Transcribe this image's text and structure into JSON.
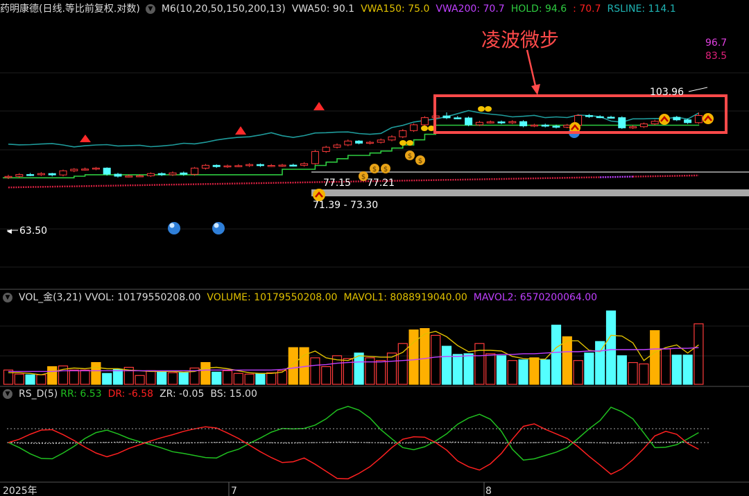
{
  "colors": {
    "up": "#ff3b3b",
    "down": "#54ffff",
    "gold": "#ffb000",
    "hold_line": "#2ecc40",
    "rsline": "#1f9c9c",
    "vwa200": "#d42040",
    "vwa_purple": "#c040ff",
    "mavol1": "#e0c000",
    "mavol2": "#c040ff",
    "rr": "#20c020",
    "dr": "#ff2020",
    "annot_box": "#ff4a4a"
  },
  "main_header": {
    "title": "药明康德(日线.等比前复权.对数)",
    "indicator": "M6(10,20,50,150,200,13)",
    "vwa50": "VWA50: 90.1",
    "vwa150": "VWA150: 75.0",
    "vwa200": "VWA200: 70.7",
    "hold": "HOLD: 94.6",
    "hold2": ": 70.7",
    "rsline": "RSLINE: 114.1"
  },
  "annotations": {
    "callout": "凌波微步",
    "rs_top": "96.7",
    "rs_second": "83.5",
    "high": "103.96",
    "left_price": "63.50",
    "zone_a": "77.15",
    "zone_b": "77.21",
    "zone_range": "71.39 - 73.30"
  },
  "vol_header": {
    "name": "VOL_金(3,21)",
    "vvol": "VVOL: 10179550208.00",
    "volume": "VOLUME: 10179550208.00",
    "mavol1": "MAVOL1: 8088919040.00",
    "mavol2": "MAVOL2: 6570200064.00"
  },
  "rs_header": {
    "name": "RS_D(5)",
    "rr": "RR: 6.53",
    "dr": "DR: -6.58",
    "zr": "ZR: -0.05",
    "bs": "BS: 15.00"
  },
  "xaxis": {
    "labels": [
      "2025年",
      "7",
      "8"
    ]
  },
  "chart_data": [
    {
      "type": "candlestick",
      "panel": "price",
      "scale": "log",
      "x": [
        1,
        2,
        3,
        4,
        5,
        6,
        7,
        8,
        9,
        10,
        11,
        12,
        13,
        14,
        15,
        16,
        17,
        18,
        19,
        20,
        21,
        22,
        23,
        24,
        25,
        26,
        27,
        28,
        29,
        30,
        31,
        32,
        33,
        34,
        35,
        36,
        37,
        38,
        39,
        40,
        41,
        42,
        43,
        44,
        45,
        46,
        47,
        48,
        49,
        50,
        51,
        52,
        53,
        54,
        55,
        56,
        57,
        58,
        59,
        60,
        61,
        62,
        63,
        64
      ],
      "open": [
        62.7,
        63.2,
        64.1,
        64.0,
        64.6,
        63.9,
        66.0,
        66.8,
        66.9,
        67.4,
        64.3,
        63.3,
        63.4,
        63.5,
        64.6,
        64.0,
        64.9,
        64.2,
        67.4,
        68.9,
        68.2,
        68.6,
        68.7,
        69.3,
        68.7,
        68.8,
        69.0,
        68.9,
        69.8,
        76.7,
        79.3,
        80.7,
        83.2,
        81.8,
        82.4,
        83.9,
        86.0,
        90.2,
        94.4,
        99.8,
        101.2,
        99.7,
        99.6,
        94.4,
        96.3,
        96.6,
        95.9,
        96.8,
        93.6,
        94.2,
        93.4,
        92.7,
        94.1,
        101.5,
        100.6,
        100.2,
        99.8,
        92.2,
        93.0,
        95.1,
        97.0,
        100.1,
        98.1,
        96.0
      ],
      "close": [
        63.2,
        64.1,
        64.0,
        64.6,
        63.9,
        66.0,
        66.8,
        66.9,
        67.4,
        64.3,
        63.3,
        63.4,
        63.5,
        64.6,
        64.0,
        64.9,
        64.2,
        67.4,
        68.9,
        68.2,
        68.6,
        68.7,
        69.3,
        68.7,
        68.8,
        69.0,
        68.9,
        69.8,
        76.7,
        79.3,
        80.7,
        83.2,
        81.8,
        82.4,
        83.9,
        86.0,
        90.2,
        94.4,
        99.8,
        101.2,
        99.7,
        99.6,
        94.4,
        96.3,
        96.6,
        95.9,
        96.8,
        93.6,
        94.2,
        93.4,
        92.7,
        94.1,
        101.5,
        100.6,
        100.2,
        99.8,
        92.2,
        93.0,
        95.1,
        97.0,
        100.1,
        98.1,
        96.0,
        101.5
      ],
      "high": [
        64.0,
        64.8,
        64.9,
        65.3,
        65.0,
        66.6,
        67.4,
        67.7,
        68.0,
        67.8,
        64.9,
        64.2,
        64.2,
        65.2,
        65.2,
        65.7,
        65.6,
        68.0,
        69.6,
        69.4,
        69.3,
        69.5,
        70.0,
        69.9,
        69.6,
        69.7,
        69.8,
        70.6,
        77.7,
        80.2,
        81.7,
        84.2,
        83.8,
        83.3,
        84.9,
        87.1,
        91.3,
        95.5,
        101.0,
        102.5,
        104.0,
        101.2,
        100.7,
        97.4,
        97.7,
        97.6,
        97.9,
        97.9,
        95.2,
        95.3,
        94.5,
        95.1,
        102.6,
        102.7,
        101.7,
        101.3,
        100.9,
        94.1,
        96.1,
        98.2,
        101.3,
        101.2,
        99.2,
        103.96
      ],
      "low": [
        61.9,
        62.5,
        63.3,
        63.4,
        63.2,
        63.2,
        65.3,
        66.1,
        66.3,
        63.6,
        62.6,
        62.7,
        62.8,
        62.9,
        63.4,
        63.4,
        63.5,
        63.5,
        66.6,
        67.5,
        67.5,
        67.9,
        68.0,
        68.0,
        68.0,
        68.1,
        68.2,
        68.2,
        69.1,
        75.9,
        78.5,
        79.9,
        81.1,
        81.0,
        81.6,
        83.1,
        85.1,
        89.3,
        93.5,
        98.9,
        98.7,
        98.6,
        93.4,
        93.5,
        95.4,
        94.9,
        95.0,
        92.6,
        92.7,
        92.5,
        91.7,
        91.9,
        93.2,
        99.6,
        99.4,
        99.1,
        91.4,
        91.4,
        92.1,
        94.1,
        96.1,
        97.2,
        95.1,
        95.1
      ]
    },
    {
      "type": "line",
      "panel": "price",
      "name": "HOLD",
      "y": [
        62.5,
        62.5,
        62.5,
        62.5,
        62.5,
        62.5,
        63.3,
        64.0,
        64.0,
        64.0,
        64.0,
        64.0,
        64.0,
        64.0,
        64.0,
        64.0,
        64.0,
        64.0,
        64.0,
        64.0,
        64.0,
        64.0,
        64.0,
        64.0,
        64.0,
        66.8,
        66.8,
        66.8,
        68.8,
        70.6,
        72.5,
        74.4,
        74.4,
        75.8,
        77.0,
        78.8,
        80.7,
        84.0,
        87.7,
        94.1,
        94.1,
        94.1,
        94.1,
        94.1,
        94.1,
        94.1,
        94.1,
        94.1,
        94.1,
        94.1,
        94.1,
        94.1,
        94.1,
        94.1,
        94.1,
        94.1,
        94.1,
        94.1,
        94.1,
        94.1,
        94.1,
        94.1,
        94.1,
        94.6
      ]
    },
    {
      "type": "line",
      "panel": "price",
      "name": "RSLINE",
      "y": [
        81.2,
        80.8,
        80.9,
        81.3,
        81.6,
        80.7,
        79.5,
        80.2,
        80.7,
        80.9,
        80.1,
        80.3,
        80.5,
        79.6,
        80.1,
        80.7,
        81.8,
        81.4,
        82.4,
        83.9,
        84.9,
        85.7,
        86.0,
        87.2,
        88.8,
        86.7,
        85.6,
        86.8,
        88.6,
        88.8,
        89.2,
        89.3,
        88.2,
        87.7,
        88.3,
        92.4,
        94.0,
        96.5,
        97.7,
        98.8,
        100.6,
        103.0,
        105.4,
        103.7,
        102.6,
        101.8,
        100.4,
        100.9,
        101.6,
        99.8,
        100.4,
        99.9,
        101.9,
        101.4,
        100.6,
        97.2,
        96.4,
        98.9,
        98.9,
        99.2,
        99.0,
        100.2,
        98.7,
        103.5
      ]
    },
    {
      "type": "line",
      "panel": "price",
      "name": "VWA200",
      "y": [
        58.0,
        58.08,
        58.16,
        58.25,
        58.33,
        58.41,
        58.5,
        58.58,
        58.67,
        58.75,
        58.84,
        58.92,
        59.01,
        59.1,
        59.18,
        59.27,
        59.35,
        59.44,
        59.53,
        59.61,
        59.7,
        59.79,
        59.88,
        59.97,
        60.05,
        60.14,
        60.23,
        60.32,
        60.41,
        60.5,
        60.59,
        60.68,
        60.77,
        60.86,
        60.95,
        61.04,
        61.13,
        61.22,
        61.31,
        61.4,
        61.49,
        61.58,
        61.68,
        61.77,
        61.86,
        61.95,
        62.04,
        62.14,
        62.23,
        62.32,
        62.42,
        62.51,
        62.61,
        62.7,
        62.79,
        62.89,
        62.98,
        63.08,
        63.17,
        63.27,
        63.36,
        63.46,
        63.55,
        63.65
      ]
    },
    {
      "type": "bar",
      "panel": "volume",
      "name": "VOLUME",
      "values": [
        2.1,
        1.5,
        1.4,
        1.4,
        2.6,
        2.7,
        2.1,
        2.1,
        3.2,
        1.6,
        2.2,
        2.5,
        1.3,
        2.0,
        1.9,
        1.7,
        1.7,
        2.4,
        3.2,
        1.8,
        2.0,
        1.6,
        1.5,
        1.6,
        1.7,
        2.0,
        5.4,
        5.4,
        3.9,
        2.6,
        4.2,
        3.8,
        4.6,
        3.9,
        3.5,
        4.6,
        6.0,
        8.0,
        8.2,
        7.2,
        5.6,
        4.4,
        4.5,
        6.0,
        4.5,
        4.2,
        3.5,
        3.6,
        3.9,
        3.6,
        8.7,
        7.0,
        3.5,
        4.6,
        6.3,
        10.8,
        4.2,
        3.2,
        3.0,
        7.9,
        5.2,
        4.3,
        4.3,
        8.9
      ],
      "gold": [
        4,
        8,
        18,
        26,
        27,
        37,
        38,
        48,
        51,
        59
      ]
    },
    {
      "type": "line",
      "panel": "volume",
      "name": "MAVOL1",
      "y": [
        1.7,
        1.7,
        1.6,
        1.4,
        1.8,
        2.2,
        2.4,
        2.3,
        2.5,
        2.3,
        2.3,
        2.1,
        2.0,
        1.9,
        1.9,
        1.9,
        1.8,
        1.9,
        2.4,
        2.5,
        2.3,
        2.0,
        1.7,
        1.6,
        1.6,
        1.8,
        3.0,
        4.3,
        4.9,
        3.9,
        3.6,
        3.5,
        4.2,
        4.1,
        4.0,
        4.0,
        4.7,
        6.2,
        7.4,
        7.8,
        7.0,
        5.7,
        4.8,
        5.0,
        5.0,
        4.9,
        4.1,
        3.8,
        3.7,
        3.7,
        5.4,
        6.4,
        6.4,
        5.0,
        4.8,
        7.2,
        7.1,
        6.1,
        3.5,
        4.7,
        5.4,
        5.8,
        4.6,
        5.8
      ]
    },
    {
      "type": "line",
      "panel": "volume",
      "name": "MAVOL2",
      "y": [
        1.9,
        1.9,
        1.9,
        1.9,
        1.9,
        2.0,
        2.0,
        2.0,
        2.0,
        2.0,
        2.0,
        2.0,
        2.0,
        2.0,
        2.0,
        2.0,
        2.0,
        2.0,
        2.1,
        2.1,
        2.1,
        2.1,
        2.1,
        2.1,
        2.1,
        2.2,
        2.4,
        2.6,
        2.8,
        2.9,
        3.1,
        3.2,
        3.3,
        3.3,
        3.3,
        3.4,
        3.5,
        3.6,
        3.8,
        4.0,
        4.1,
        4.1,
        4.2,
        4.2,
        4.3,
        4.4,
        4.4,
        4.5,
        4.5,
        4.6,
        4.7,
        4.8,
        4.8,
        4.9,
        4.9,
        5.1,
        5.1,
        5.1,
        5.1,
        5.2,
        5.2,
        5.3,
        5.3,
        5.4
      ]
    },
    {
      "type": "line",
      "panel": "rs",
      "name": "RR",
      "y": [
        0.0,
        -1.2,
        -2.7,
        -3.8,
        -3.9,
        -2.5,
        -0.9,
        1.0,
        2.4,
        3.0,
        2.1,
        1.0,
        0.2,
        -0.5,
        -1.3,
        -2.2,
        -2.6,
        -3.1,
        -3.6,
        -3.7,
        -2.4,
        -1.6,
        -0.2,
        1.1,
        2.5,
        3.4,
        3.3,
        3.4,
        4.2,
        5.7,
        7.8,
        8.7,
        7.8,
        5.9,
        3.1,
        0.9,
        -1.2,
        -1.7,
        -1.0,
        0.4,
        2.1,
        4.4,
        5.9,
        6.8,
        5.6,
        2.7,
        -1.6,
        -4.2,
        -3.9,
        -3.1,
        -2.3,
        -1.2,
        1.0,
        3.3,
        5.3,
        8.5,
        7.4,
        5.7,
        2.3,
        -1.2,
        -1.1,
        -0.5,
        0.9,
        2.4
      ]
    },
    {
      "type": "line",
      "panel": "rs",
      "name": "DR",
      "y": [
        0.0,
        0.8,
        2.0,
        3.0,
        3.1,
        1.9,
        0.5,
        -1.1,
        -2.5,
        -3.4,
        -2.6,
        -1.4,
        -0.5,
        0.4,
        1.2,
        1.9,
        2.7,
        3.3,
        3.8,
        3.5,
        2.3,
        1.0,
        -0.6,
        -2.2,
        -3.6,
        -4.8,
        -4.6,
        -3.7,
        -5.2,
        -6.9,
        -8.6,
        -8.7,
        -7.4,
        -5.8,
        -3.6,
        -1.2,
        0.8,
        1.4,
        1.3,
        0.0,
        -1.8,
        -4.4,
        -5.8,
        -6.6,
        -5.1,
        -2.6,
        0.8,
        3.9,
        4.5,
        3.2,
        2.1,
        1.0,
        -1.0,
        -3.3,
        -5.4,
        -7.6,
        -6.3,
        -4.1,
        -1.4,
        1.6,
        2.7,
        2.0,
        -0.2,
        -1.6
      ]
    },
    {
      "type": "line",
      "panel": "rs",
      "name": "ZR",
      "y": [
        0.0,
        -0.1,
        -0.15,
        -0.2,
        -0.2,
        -0.15,
        -0.1,
        -0.05,
        0.0,
        0.05,
        0.1,
        0.1,
        0.05,
        0.0,
        -0.05,
        -0.1,
        -0.1,
        -0.05,
        0.0,
        0.05,
        0.1,
        0.1,
        0.05,
        0.0,
        -0.05,
        -0.1,
        -0.1,
        -0.05,
        0.0,
        0.05,
        0.1,
        0.1,
        0.05,
        0.0,
        -0.05,
        -0.1,
        -0.1,
        -0.05,
        0.0,
        0.05,
        0.1,
        0.1,
        0.05,
        0.0,
        -0.05,
        -0.1,
        -0.1,
        -0.05,
        0.0,
        0.05,
        0.1,
        0.1,
        0.05,
        0.0,
        -0.05,
        -0.1,
        -0.1,
        -0.05,
        0.0,
        0.05,
        0.1,
        0.1,
        0.05,
        -0.05
      ]
    }
  ]
}
